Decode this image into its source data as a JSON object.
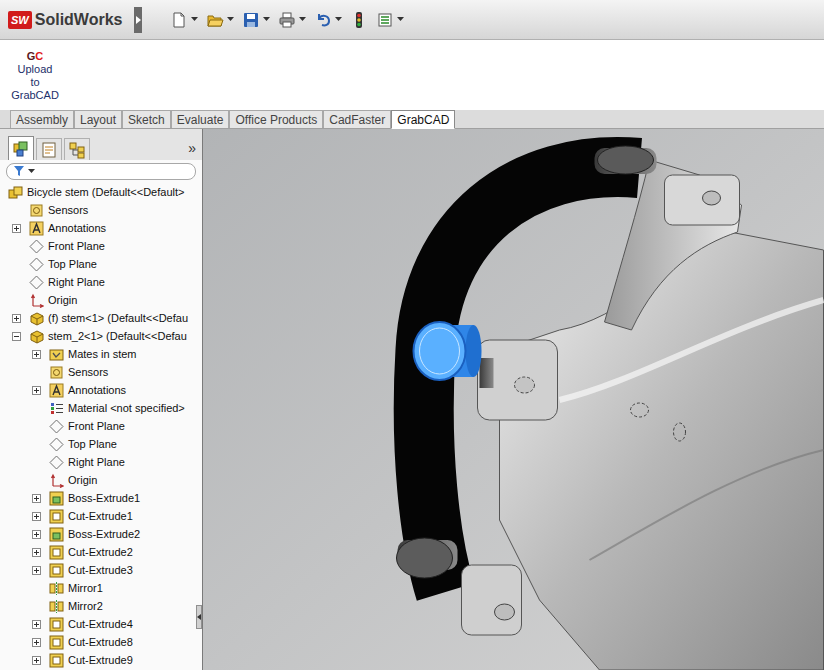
{
  "app": {
    "logo": "SW",
    "title": "SolidWorks"
  },
  "ribbon": {
    "buttons": [
      {
        "logo": [
          "G",
          "C"
        ],
        "label_lines": [
          "Upload",
          "to",
          "GrabCAD"
        ]
      }
    ]
  },
  "tabs": [
    {
      "label": "Assembly",
      "selected": false
    },
    {
      "label": "Layout",
      "selected": false
    },
    {
      "label": "Sketch",
      "selected": false
    },
    {
      "label": "Evaluate",
      "selected": false
    },
    {
      "label": "Office Products",
      "selected": false
    },
    {
      "label": "CadFaster",
      "selected": false
    },
    {
      "label": "GrabCAD",
      "selected": true
    }
  ],
  "panel": {
    "tabs": [
      {
        "kind": "feature-tree",
        "selected": true
      },
      {
        "kind": "property",
        "selected": false
      },
      {
        "kind": "configuration",
        "selected": false
      }
    ],
    "collapse_glyph": "»"
  },
  "tree": {
    "label": "Bicycle stem (Default<<Default>",
    "kind": "assembly",
    "expander": false,
    "expanded": true,
    "children": [
      {
        "label": "Sensors",
        "kind": "sensors",
        "expander": false,
        "expanded": false
      },
      {
        "label": "Annotations",
        "kind": "annotations",
        "expander": true,
        "expanded": false
      },
      {
        "label": "Front Plane",
        "kind": "plane",
        "expander": false,
        "expanded": false
      },
      {
        "label": "Top Plane",
        "kind": "plane",
        "expander": false,
        "expanded": false
      },
      {
        "label": "Right Plane",
        "kind": "plane",
        "expander": false,
        "expanded": false
      },
      {
        "label": "Origin",
        "kind": "origin",
        "expander": false,
        "expanded": false
      },
      {
        "label": "(f) stem<1> (Default<<Defau",
        "kind": "part",
        "expander": true,
        "expanded": false
      },
      {
        "label": "stem_2<1> (Default<<Defau",
        "kind": "part",
        "expander": true,
        "expanded": true,
        "children": [
          {
            "label": "Mates in stem",
            "kind": "mates",
            "expander": true,
            "expanded": false
          },
          {
            "label": "Sensors",
            "kind": "sensors",
            "expander": false,
            "expanded": false
          },
          {
            "label": "Annotations",
            "kind": "annotations",
            "expander": true,
            "expanded": false
          },
          {
            "label": "Material <not specified>",
            "kind": "material",
            "expander": false,
            "expanded": false
          },
          {
            "label": "Front Plane",
            "kind": "plane",
            "expander": false,
            "expanded": false
          },
          {
            "label": "Top Plane",
            "kind": "plane",
            "expander": false,
            "expanded": false
          },
          {
            "label": "Right Plane",
            "kind": "plane",
            "expander": false,
            "expanded": false
          },
          {
            "label": "Origin",
            "kind": "origin",
            "expander": false,
            "expanded": false
          },
          {
            "label": "Boss-Extrude1",
            "kind": "boss",
            "expander": true,
            "expanded": false
          },
          {
            "label": "Cut-Extrude1",
            "kind": "cut",
            "expander": true,
            "expanded": false
          },
          {
            "label": "Boss-Extrude2",
            "kind": "boss",
            "expander": true,
            "expanded": false
          },
          {
            "label": "Cut-Extrude2",
            "kind": "cut",
            "expander": true,
            "expanded": false
          },
          {
            "label": "Cut-Extrude3",
            "kind": "cut",
            "expander": true,
            "expanded": false
          },
          {
            "label": "Mirror1",
            "kind": "mirror",
            "expander": false,
            "expanded": false
          },
          {
            "label": "Mirror2",
            "kind": "mirror",
            "expander": false,
            "expanded": false
          },
          {
            "label": "Cut-Extrude4",
            "kind": "cut",
            "expander": true,
            "expanded": false
          },
          {
            "label": "Cut-Extrude8",
            "kind": "cut",
            "expander": true,
            "expanded": false
          },
          {
            "label": "Cut-Extrude9",
            "kind": "cut",
            "expander": true,
            "expanded": false
          }
        ]
      }
    ]
  }
}
